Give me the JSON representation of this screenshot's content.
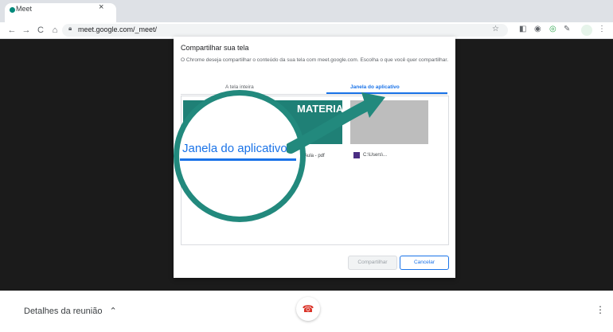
{
  "browser": {
    "tab_title": "Meet",
    "tab_close": "×",
    "url": "meet.google.com/_meet/",
    "nav": {
      "back": "←",
      "forward": "→",
      "reload": "C",
      "home": "⌂"
    }
  },
  "dialog": {
    "title": "Compartilhar sua tela",
    "description": "O Chrome deseja compartilhar o conteúdo da sua tela com meet.google.com. Escolha o que você quer compartilhar.",
    "tabs": [
      "A tela inteira",
      "Janela do aplicativo"
    ],
    "active_tab": "Janela do aplicativo",
    "items": [
      {
        "thumb_text": "MATERIAL",
        "label": "Aula - pdf"
      },
      {
        "label": "C:\\Users\\..."
      }
    ],
    "share_button": "Compartilhar",
    "cancel_button": "Cancelar"
  },
  "magnifier": {
    "text": "Janela do aplicativo"
  },
  "bottom": {
    "details_label": "Detalhes da reunião"
  },
  "colors": {
    "accent": "#1a73e8",
    "teal": "#22897d",
    "end_call": "#d93025"
  }
}
